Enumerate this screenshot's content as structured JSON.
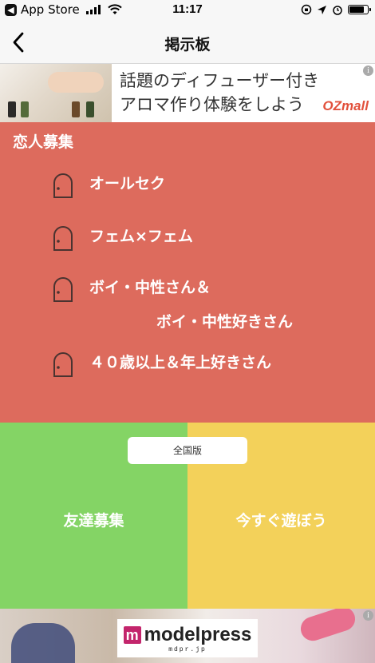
{
  "status_bar": {
    "back_app": "App Store",
    "time": "11:17",
    "battery_level": 0.8
  },
  "nav": {
    "title": "掲示板",
    "back_icon": "chevron-left-icon"
  },
  "ad_top": {
    "line1": "話題のディフューザー付き",
    "line2": "アロマ作り体験をしよう",
    "brand": "OZmall",
    "info": "i"
  },
  "love_section": {
    "heading": "恋人募集",
    "items": [
      {
        "label": "オールセク",
        "icon": "door-icon"
      },
      {
        "label": "フェム×フェム",
        "icon": "door-icon"
      },
      {
        "label": "ボイ・中性さん＆",
        "label2": "ボイ・中性好きさん",
        "icon": "door-icon"
      },
      {
        "label": "４０歳以上＆年上好きさん",
        "icon": "door-icon"
      }
    ],
    "color": "#dd6b5d"
  },
  "split": {
    "nationwide_label": "全国版",
    "friends_label": "友達募集",
    "play_label": "今すぐ遊ぼう",
    "friends_color": "#84d465",
    "play_color": "#f3d15a"
  },
  "ad_bottom": {
    "brand": "modelpress",
    "sub": "mdpr.jp",
    "info": "i"
  }
}
